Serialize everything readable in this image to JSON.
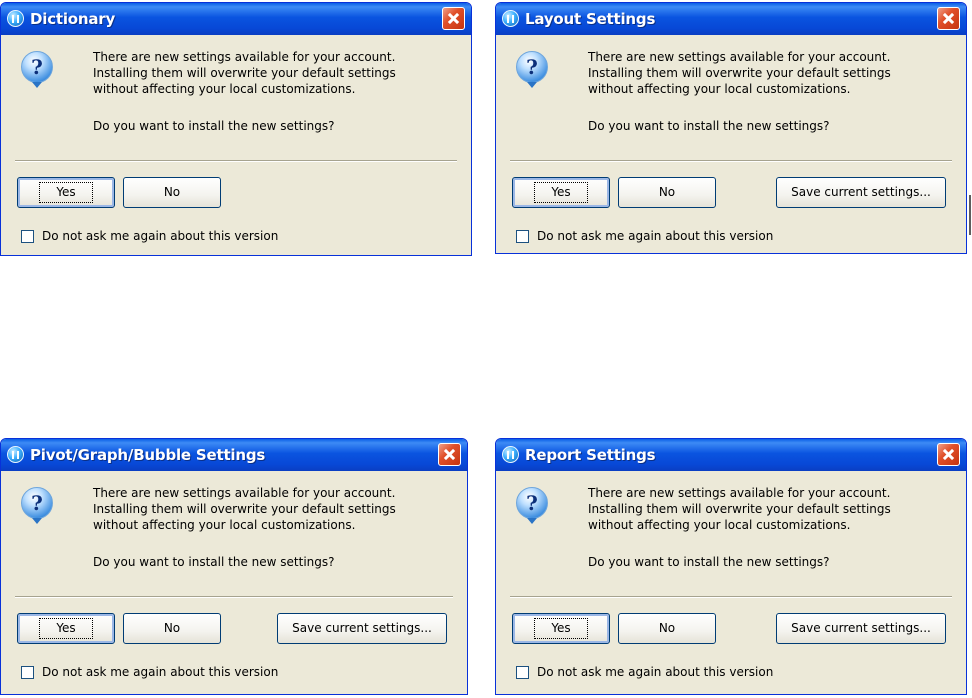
{
  "dialogs": [
    {
      "title": "Dictionary",
      "message_lines": [
        "There are new settings available for your account.",
        "Installing them will overwrite your default settings",
        "without affecting your local customizations."
      ],
      "question": "Do you want to install the new settings?",
      "buttons": {
        "yes": "Yes",
        "no": "No"
      },
      "checkbox": {
        "label": "Do not ask me again about this version",
        "checked": false
      }
    },
    {
      "title": "Layout Settings",
      "message_lines": [
        "There are new settings available for your account.",
        "Installing them will overwrite your default settings",
        "without affecting your local customizations."
      ],
      "question": "Do you want to install the new settings?",
      "buttons": {
        "yes": "Yes",
        "no": "No",
        "save": "Save current settings..."
      },
      "checkbox": {
        "label": "Do not ask me again about this version",
        "checked": false
      }
    },
    {
      "title": "Pivot/Graph/Bubble Settings",
      "message_lines": [
        "There are new settings available for your account.",
        "Installing them will overwrite your default settings",
        "without affecting your local customizations."
      ],
      "question": "Do you want to install the new settings?",
      "buttons": {
        "yes": "Yes",
        "no": "No",
        "save": "Save current settings..."
      },
      "checkbox": {
        "label": "Do not ask me again about this version",
        "checked": false
      }
    },
    {
      "title": "Report Settings",
      "message_lines": [
        "There are new settings available for your account.",
        "Installing them will overwrite your default settings",
        "without affecting your local customizations."
      ],
      "question": "Do you want to install the new settings?",
      "buttons": {
        "yes": "Yes",
        "no": "No",
        "save": "Save current settings..."
      },
      "checkbox": {
        "label": "Do not ask me again about this version",
        "checked": false
      }
    }
  ],
  "icons": {
    "app": "app-icon",
    "question": "question-icon",
    "close": "close-icon"
  },
  "colors": {
    "titlebar": "#0a54e0",
    "dialog_bg": "#ece9d8",
    "close": "#e0502a"
  }
}
